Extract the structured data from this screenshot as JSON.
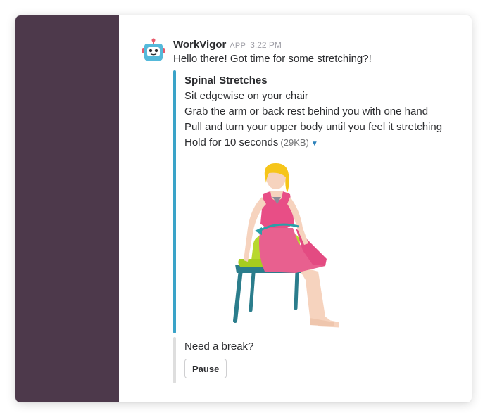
{
  "message": {
    "app_name": "WorkVigor",
    "app_badge": "APP",
    "time": "3:22 PM",
    "text": "Hello there! Got time for some stretching?!"
  },
  "attachment": {
    "title": "Spinal Stretches",
    "lines": [
      "Sit edgewise on your chair",
      "Grab the arm or back rest behind you with one hand",
      "Pull and turn your upper body until you feel it stretching",
      "Hold for 10 seconds"
    ],
    "file_size": "(29KB)",
    "accent_color": "#3aa3c8"
  },
  "prompt": {
    "text": "Need a break?",
    "button_label": "Pause"
  },
  "colors": {
    "sidebar": "#4d394b",
    "text": "#2c2d30",
    "muted": "#9e9ea6"
  },
  "icons": {
    "avatar": "robot-avatar-icon",
    "expand": "caret-down-icon"
  }
}
